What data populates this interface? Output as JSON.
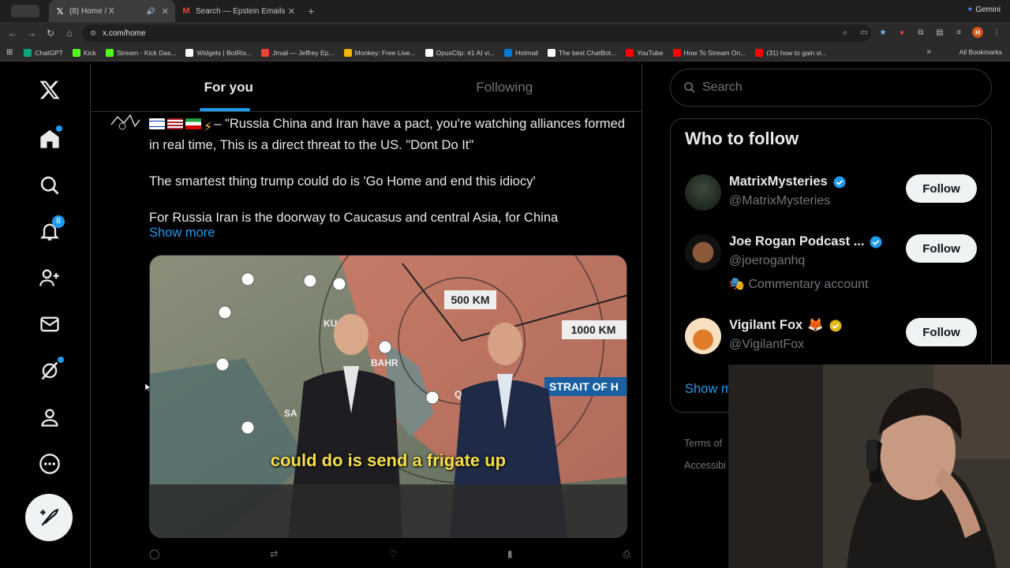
{
  "browser": {
    "tabs": [
      {
        "title": "(8) Home / X",
        "active": true
      },
      {
        "title": "Search — Epstein Emails",
        "active": false
      }
    ],
    "url": "x.com/home",
    "gemini_label": "Gemini",
    "profile_initial": "H",
    "bookmarks": [
      {
        "label": "ChatGPT",
        "color": "#10a37f"
      },
      {
        "label": "Kick",
        "color": "#53fc18"
      },
      {
        "label": "Stream - Kick Das...",
        "color": "#53fc18"
      },
      {
        "label": "Widgets | BotRix...",
        "color": "#ffffff"
      },
      {
        "label": "Jmail — Jeffrey Ep...",
        "color": "#ea4335"
      },
      {
        "label": "Monkey: Free Live...",
        "color": "#f4b400"
      },
      {
        "label": "OpusClip: #1 AI vi...",
        "color": "#ffffff"
      },
      {
        "label": "Hotmail",
        "color": "#0078d4"
      },
      {
        "label": "The best ChatBot...",
        "color": "#ffffff"
      },
      {
        "label": "YouTube",
        "color": "#ff0000"
      },
      {
        "label": "How To Stream On...",
        "color": "#ff0000"
      },
      {
        "label": "(31) how to gain vi...",
        "color": "#ff0000"
      }
    ],
    "all_bookmarks": "All Bookmarks"
  },
  "nav": {
    "notifications_count": "8"
  },
  "feed": {
    "tabs": [
      "For you",
      "Following"
    ],
    "tweet": {
      "line1": "– \"Russia China and Iran have a pact, you're watching alliances formed in real time, This is a direct threat to the US. \"Dont Do It\"",
      "line2": "The smartest thing trump could do is 'Go Home and end this idiocy'",
      "line3": "For Russia Iran is the doorway to Caucasus and central Asia, for China",
      "show_more": "Show more",
      "video_caption": "could do is send a frigate up",
      "map_labels": {
        "km500": "500 KM",
        "km1000": "1000 KM",
        "strait": "STRAIT OF H",
        "bahr": "BAHR",
        "qa": "QA",
        "ku": "KU",
        "sa": "SA"
      }
    }
  },
  "sidebar": {
    "search_placeholder": "Search",
    "who_to_follow": "Who to follow",
    "accounts": [
      {
        "name": "MatrixMysteries",
        "handle": "@MatrixMysteries",
        "badge": "blue",
        "follow": "Follow"
      },
      {
        "name": "Joe Rogan Podcast ...",
        "handle": "@joeroganhq",
        "badge": "blue",
        "sub": "Commentary account",
        "follow": "Follow"
      },
      {
        "name": "Vigilant Fox",
        "handle": "@VigilantFox",
        "badge": "gold",
        "follow": "Follow"
      }
    ],
    "show_more": "Show m",
    "terms": "Terms of",
    "accessibility": "Accessibi"
  }
}
